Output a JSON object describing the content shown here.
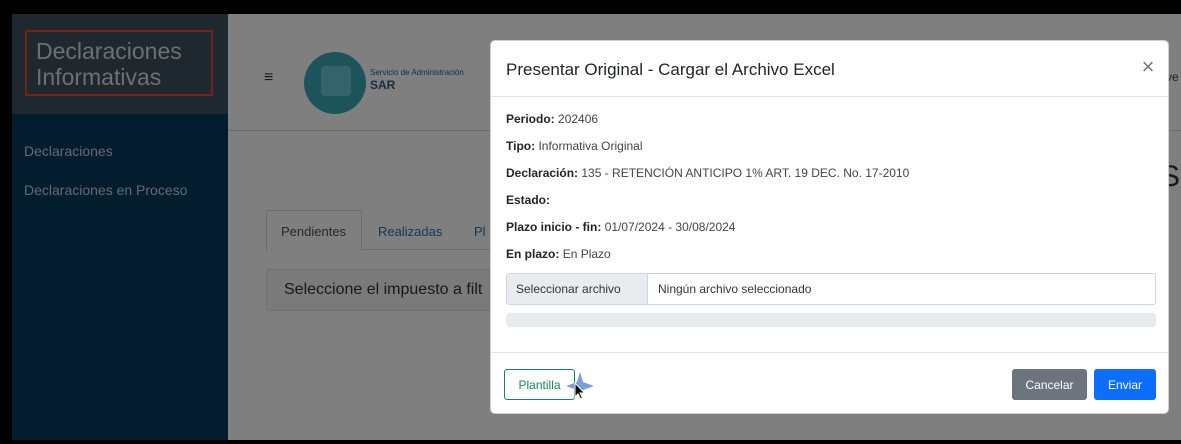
{
  "sidebar": {
    "title": "Declaraciones Informativas",
    "items": [
      {
        "label": "Declaraciones"
      },
      {
        "label": "Declaraciones en Proceso"
      }
    ]
  },
  "header": {
    "logo_org": "Servicio de Administración",
    "logo_name": "SAR",
    "right_fragment": "ve",
    "page_heading_fragment": "S"
  },
  "tabs": [
    {
      "label": "Pendientes"
    },
    {
      "label": "Realizadas"
    },
    {
      "label": "Pl"
    }
  ],
  "filter": {
    "text": "Seleccione el impuesto a filt"
  },
  "modal": {
    "title": "Presentar Original - Cargar el Archivo Excel",
    "close_symbol": "×",
    "fields": [
      {
        "label": "Periodo:",
        "value": "202406"
      },
      {
        "label": "Tipo:",
        "value": "Informativa Original"
      },
      {
        "label": "Declaración:",
        "value": "135 - RETENCIÓN ANTICIPO 1% ART. 19 DEC. No. 17-2010"
      },
      {
        "label": "Estado:",
        "value": ""
      },
      {
        "label": "Plazo inicio - fin:",
        "value": "01/07/2024 - 30/08/2024"
      },
      {
        "label": "En plazo:",
        "value": "En Plazo"
      }
    ],
    "file_input": {
      "button_label": "Seleccionar archivo",
      "filename": "Ningún archivo seleccionado"
    },
    "progress": 0,
    "footer": {
      "template_label": "Plantilla",
      "cancel_label": "Cancelar",
      "send_label": "Enviar"
    }
  },
  "colors": {
    "sidebar_bg": "#06385c",
    "brand_bg": "#3e4f5e",
    "brand_outline": "#e2483a",
    "primary": "#0d6efd",
    "secondary": "#6c757d",
    "success": "#198754"
  }
}
